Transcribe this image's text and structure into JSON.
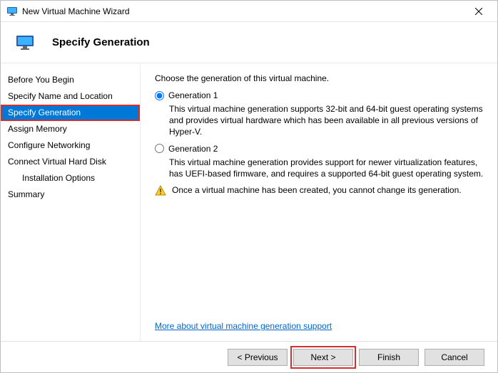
{
  "titlebar": {
    "title": "New Virtual Machine Wizard"
  },
  "header": {
    "page_title": "Specify Generation"
  },
  "sidebar": {
    "steps": [
      {
        "label": "Before You Begin",
        "selected": false,
        "indent": false
      },
      {
        "label": "Specify Name and Location",
        "selected": false,
        "indent": false
      },
      {
        "label": "Specify Generation",
        "selected": true,
        "indent": false
      },
      {
        "label": "Assign Memory",
        "selected": false,
        "indent": false
      },
      {
        "label": "Configure Networking",
        "selected": false,
        "indent": false
      },
      {
        "label": "Connect Virtual Hard Disk",
        "selected": false,
        "indent": false
      },
      {
        "label": "Installation Options",
        "selected": false,
        "indent": true
      },
      {
        "label": "Summary",
        "selected": false,
        "indent": false
      }
    ]
  },
  "content": {
    "intro": "Choose the generation of this virtual machine.",
    "options": [
      {
        "label": "Generation 1",
        "selected": true,
        "description": "This virtual machine generation supports 32-bit and 64-bit guest operating systems and provides virtual hardware which has been available in all previous versions of Hyper-V."
      },
      {
        "label": "Generation 2",
        "selected": false,
        "description": "This virtual machine generation provides support for newer virtualization features, has UEFI-based firmware, and requires a supported 64-bit guest operating system."
      }
    ],
    "warning": "Once a virtual machine has been created, you cannot change its generation.",
    "help_link": "More about virtual machine generation support"
  },
  "footer": {
    "previous": "< Previous",
    "next": "Next >",
    "finish": "Finish",
    "cancel": "Cancel"
  }
}
